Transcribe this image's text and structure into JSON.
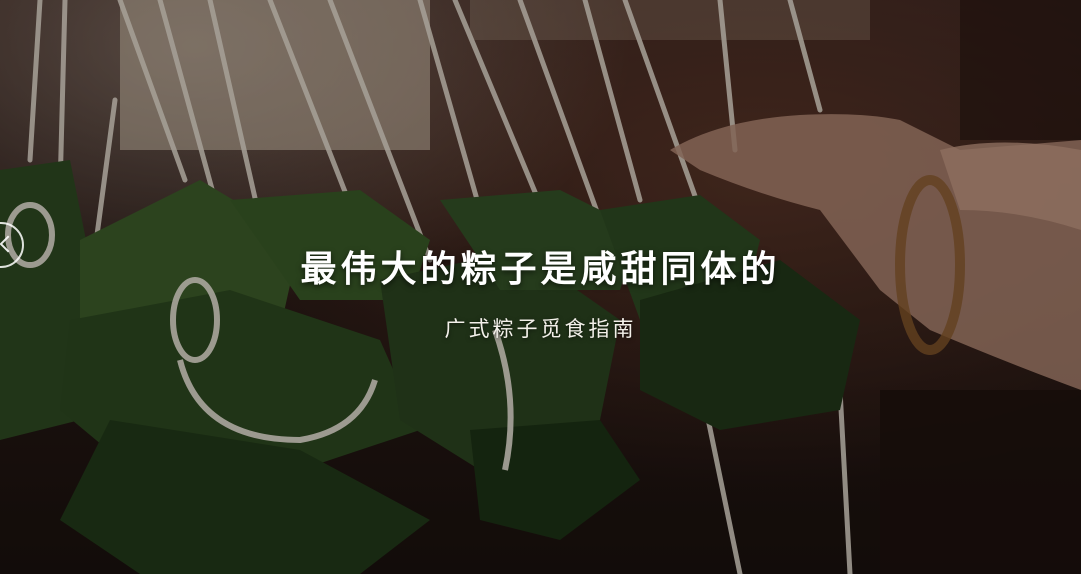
{
  "banner": {
    "headline": "最伟大的粽子是咸甜同体的",
    "subheadline": "广式粽子觅食指南",
    "prev_icon": "chevron-left-icon"
  }
}
